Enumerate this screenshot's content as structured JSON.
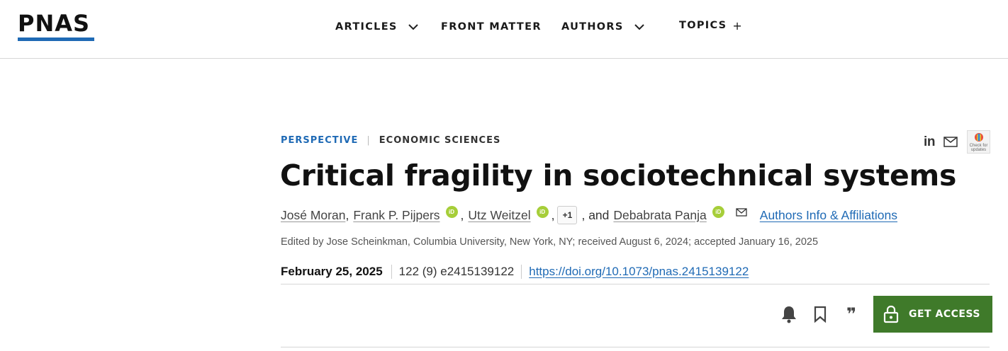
{
  "header": {
    "logo": "PNAS",
    "nav": [
      {
        "label": "ARTICLES",
        "has_dropdown": true
      },
      {
        "label": "FRONT MATTER",
        "has_dropdown": false
      },
      {
        "label": "AUTHORS",
        "has_dropdown": true
      },
      {
        "label": "TOPICS",
        "expand_symbol": "+"
      }
    ]
  },
  "article": {
    "type": "PERSPECTIVE",
    "separator": "|",
    "category": "ECONOMIC SCIENCES",
    "title": "Critical fragility in sociotechnical systems",
    "authors": [
      {
        "name": "José Moran",
        "orcid": false
      },
      {
        "name": "Frank P. Pijpers",
        "orcid": true
      },
      {
        "name": "Utz Weitzel",
        "orcid": true
      },
      {
        "name": "Debabrata Panja",
        "orcid": true,
        "corresponding": true
      }
    ],
    "more_authors_label": "+1",
    "and_label": ", and",
    "orcid_label": "iD",
    "affiliations_link": "Authors Info & Affiliations",
    "edited_line": "Edited by Jose Scheinkman, Columbia University, New York, NY; received August 6, 2024; accepted January 16, 2025",
    "pub_date": "February 25, 2025",
    "volume_issue": "122 (9) e2415139122",
    "doi": "https://doi.org/10.1073/pnas.2415139122"
  },
  "share": {
    "linkedin_label": "in",
    "email_icon": "envelope-icon",
    "crossmark_label": "Check for updates"
  },
  "actions": {
    "alert_icon": "bell-icon",
    "bookmark_icon": "bookmark-icon",
    "cite_icon": "quote-icon",
    "cite_symbol": "❞",
    "get_access_label": "GET ACCESS"
  },
  "colors": {
    "brand_blue": "#1f6ab5",
    "access_green": "#3f7a2a",
    "orcid_green": "#a6ce39"
  }
}
